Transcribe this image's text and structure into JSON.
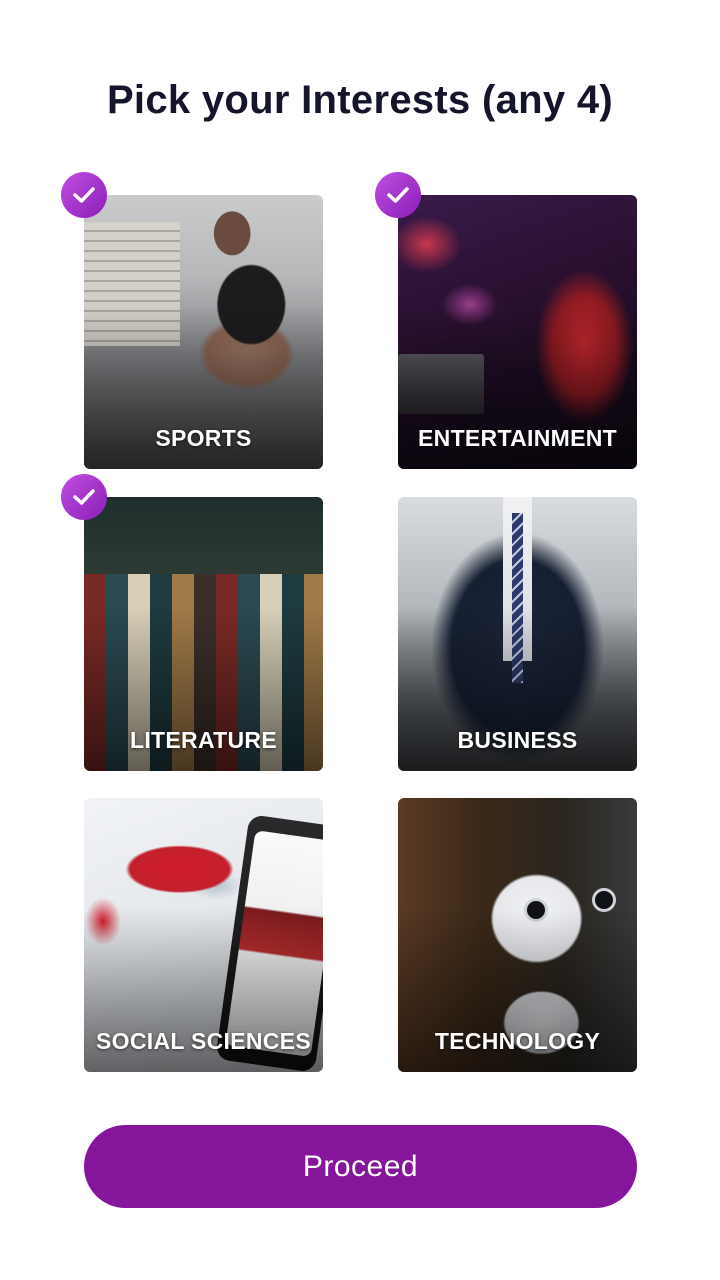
{
  "title": "Pick your Interests (any 4)",
  "accent_color": "#85169c",
  "check_icon": "check-icon",
  "interests": [
    {
      "label": "SPORTS",
      "selected": true
    },
    {
      "label": "ENTERTAINMENT",
      "selected": true
    },
    {
      "label": "LITERATURE",
      "selected": true
    },
    {
      "label": "BUSINESS",
      "selected": false
    },
    {
      "label": "SOCIAL SCIENCES",
      "selected": false
    },
    {
      "label": "TECHNOLOGY",
      "selected": false
    }
  ],
  "proceed_label": "Proceed"
}
